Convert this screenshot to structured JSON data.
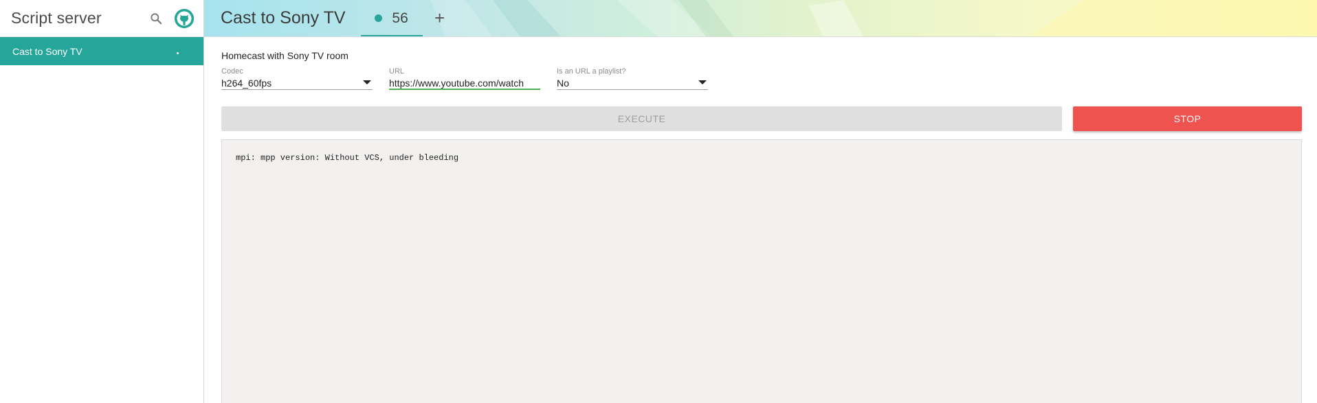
{
  "app": {
    "title": "Script server"
  },
  "sidebar": {
    "items": [
      {
        "label": "Cast to Sony TV",
        "active": true,
        "running": true
      }
    ]
  },
  "header": {
    "title": "Cast to Sony TV",
    "execution_tab": {
      "id": "56"
    },
    "add_tab": "+"
  },
  "script": {
    "description": "Homecast with Sony TV room",
    "params": {
      "codec": {
        "label": "Codec",
        "value": "h264_60fps"
      },
      "url": {
        "label": "URL",
        "value": "https://www.youtube.com/watch"
      },
      "playlist": {
        "label": "Is an URL a playlist?",
        "value": "No"
      }
    }
  },
  "actions": {
    "execute": "EXECUTE",
    "stop": "STOP"
  },
  "log": {
    "text": "mpi: mpp version: Without VCS, under bleeding"
  },
  "colors": {
    "accent": "#26a69a",
    "stop": "#ef5350",
    "url_underline": "#4caf50",
    "log_bg": "#f2f1ef"
  },
  "icons": [
    "search-icon",
    "github-icon",
    "status-dot-icon",
    "plus-icon",
    "dropdown-arrow-icon"
  ]
}
